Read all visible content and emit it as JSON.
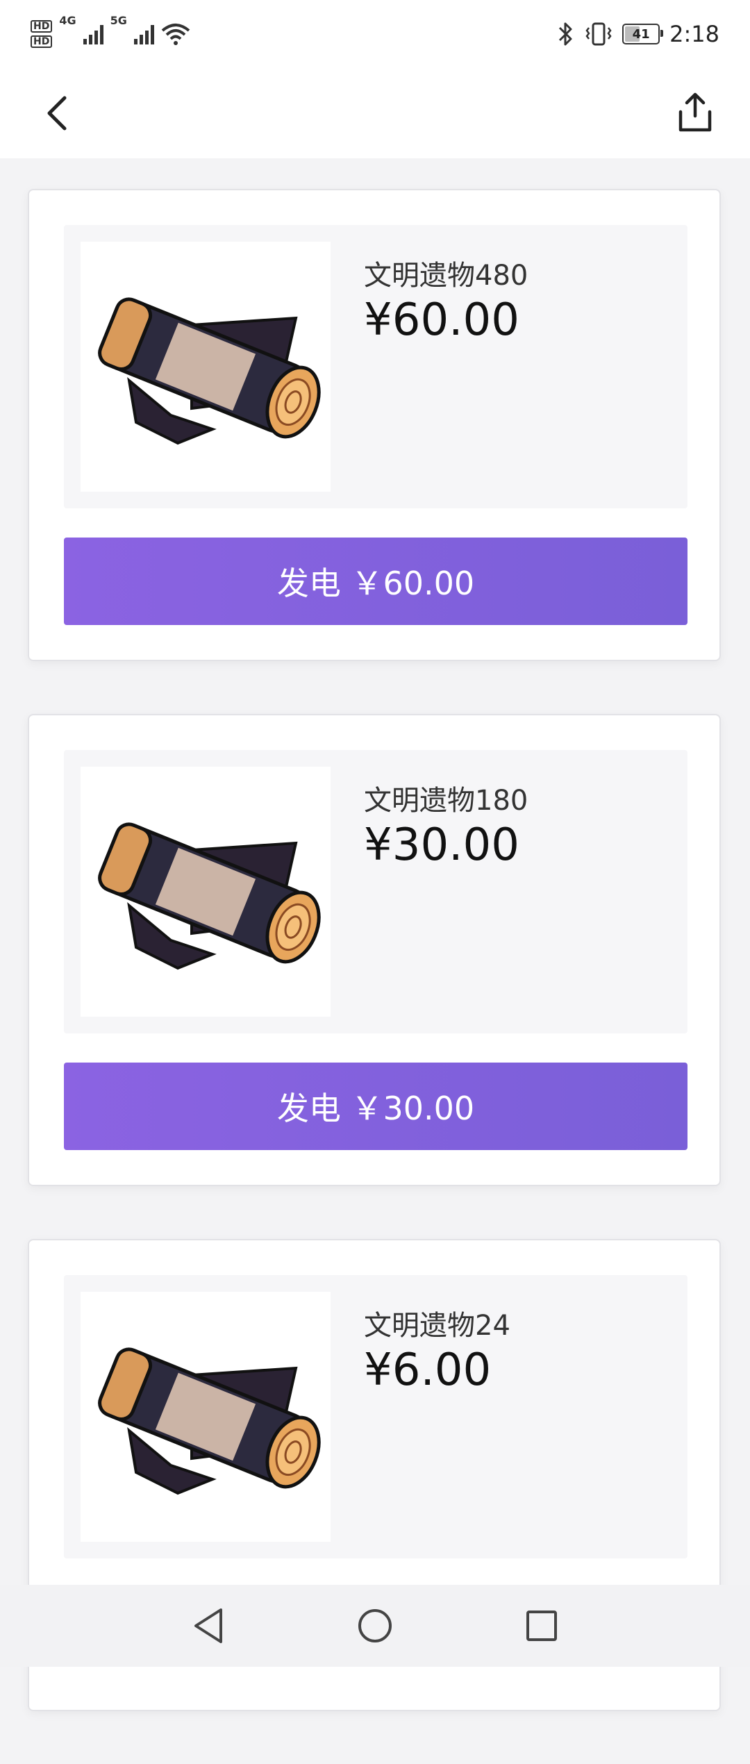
{
  "status_bar": {
    "hd1": "HD",
    "hd2": "HD",
    "net1": "4G",
    "net2": "5G",
    "battery": "41",
    "time": "2:18",
    "icons": [
      "bluetooth-icon",
      "vibrate-icon",
      "wifi-icon",
      "signal-icon",
      "battery-icon"
    ]
  },
  "nav": {
    "back_icon": "chevron-left-icon",
    "share_icon": "share-icon"
  },
  "items": [
    {
      "name": "文明遗物480",
      "price": "¥60.00",
      "button": "发电 ￥60.00"
    },
    {
      "name": "文明遗物180",
      "price": "¥30.00",
      "button": "发电 ￥30.00"
    },
    {
      "name": "文明遗物24",
      "price": "¥6.00",
      "button": ""
    }
  ],
  "colors": {
    "accent_start": "#8b63e2",
    "accent_end": "#7a5fd8",
    "background": "#f3f3f5"
  },
  "system_nav": [
    "back-triangle-icon",
    "home-circle-icon",
    "recents-square-icon"
  ]
}
